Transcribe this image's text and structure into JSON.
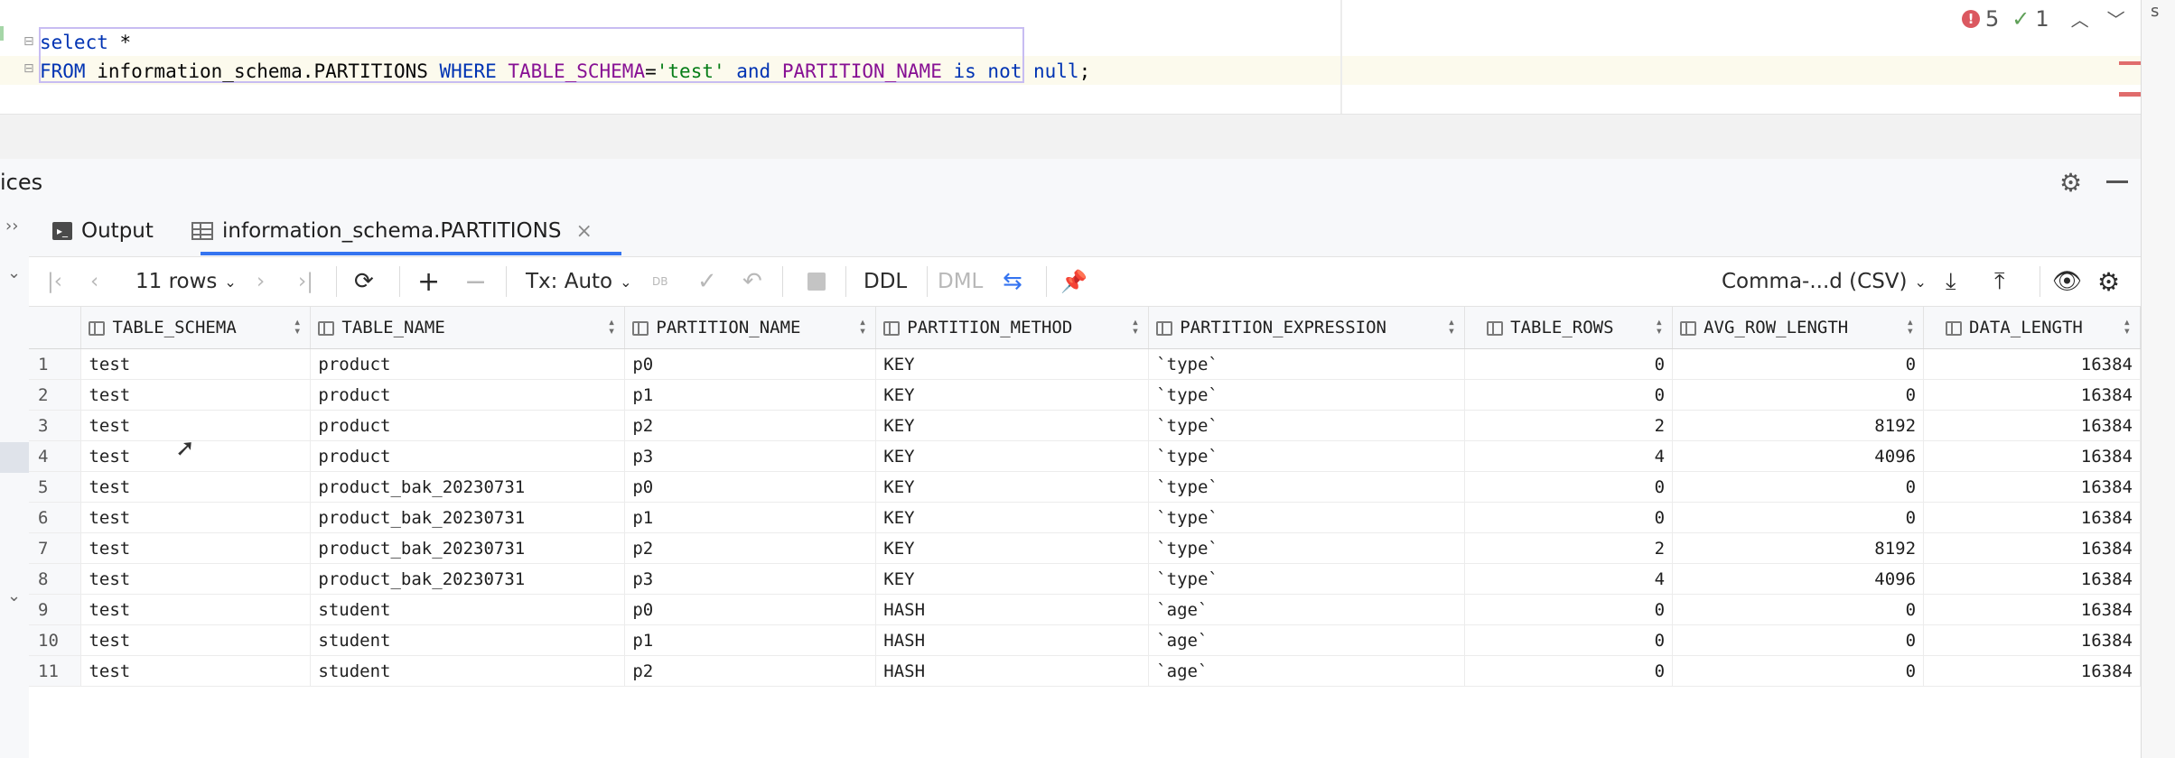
{
  "editor": {
    "line1": {
      "kw1": "select",
      "rest": " *"
    },
    "line2": {
      "kw_from": "FROM",
      "table": " information_schema.PARTITIONS ",
      "kw_where": "WHERE",
      "col1": " TABLE_SCHEMA",
      "eq": "=",
      "str": "'test'",
      "kw_and": " and ",
      "col2": "PARTITION_NAME",
      "kw_isnot": " is not null",
      "semi": ";"
    },
    "inspections": {
      "errors": "5",
      "warnings": "1"
    }
  },
  "services": {
    "title": "ices"
  },
  "tabs": [
    {
      "label": "Output",
      "icon": "console-icon"
    },
    {
      "label": "information_schema.PARTITIONS",
      "icon": "table-icon",
      "active": true
    }
  ],
  "toolbar": {
    "rows_label": "11 rows",
    "tx_label": "Tx: Auto",
    "db_label": "DB",
    "ddl_label": "DDL",
    "dml_label": "DML",
    "format_label": "Comma-...d (CSV)"
  },
  "grid": {
    "columns": [
      "TABLE_SCHEMA",
      "TABLE_NAME",
      "PARTITION_NAME",
      "PARTITION_METHOD",
      "PARTITION_EXPRESSION",
      "TABLE_ROWS",
      "AVG_ROW_LENGTH",
      "DATA_LENGTH"
    ],
    "rows": [
      [
        "1",
        "test",
        "product",
        "p0",
        "KEY",
        "`type`",
        "0",
        "0",
        "16384"
      ],
      [
        "2",
        "test",
        "product",
        "p1",
        "KEY",
        "`type`",
        "0",
        "0",
        "16384"
      ],
      [
        "3",
        "test",
        "product",
        "p2",
        "KEY",
        "`type`",
        "2",
        "8192",
        "16384"
      ],
      [
        "4",
        "test",
        "product",
        "p3",
        "KEY",
        "`type`",
        "4",
        "4096",
        "16384"
      ],
      [
        "5",
        "test",
        "product_bak_20230731",
        "p0",
        "KEY",
        "`type`",
        "0",
        "0",
        "16384"
      ],
      [
        "6",
        "test",
        "product_bak_20230731",
        "p1",
        "KEY",
        "`type`",
        "0",
        "0",
        "16384"
      ],
      [
        "7",
        "test",
        "product_bak_20230731",
        "p2",
        "KEY",
        "`type`",
        "2",
        "8192",
        "16384"
      ],
      [
        "8",
        "test",
        "product_bak_20230731",
        "p3",
        "KEY",
        "`type`",
        "4",
        "4096",
        "16384"
      ],
      [
        "9",
        "test",
        "student",
        "p0",
        "HASH",
        "`age`",
        "0",
        "0",
        "16384"
      ],
      [
        "10",
        "test",
        "student",
        "p1",
        "HASH",
        "`age`",
        "0",
        "0",
        "16384"
      ],
      [
        "11",
        "test",
        "student",
        "p2",
        "HASH",
        "`age`",
        "0",
        "0",
        "16384"
      ]
    ]
  },
  "colors": {
    "accent": "#3574f0",
    "keyword": "#0033b3",
    "string": "#067d17",
    "identifier": "#871094",
    "error": "#db5860"
  }
}
